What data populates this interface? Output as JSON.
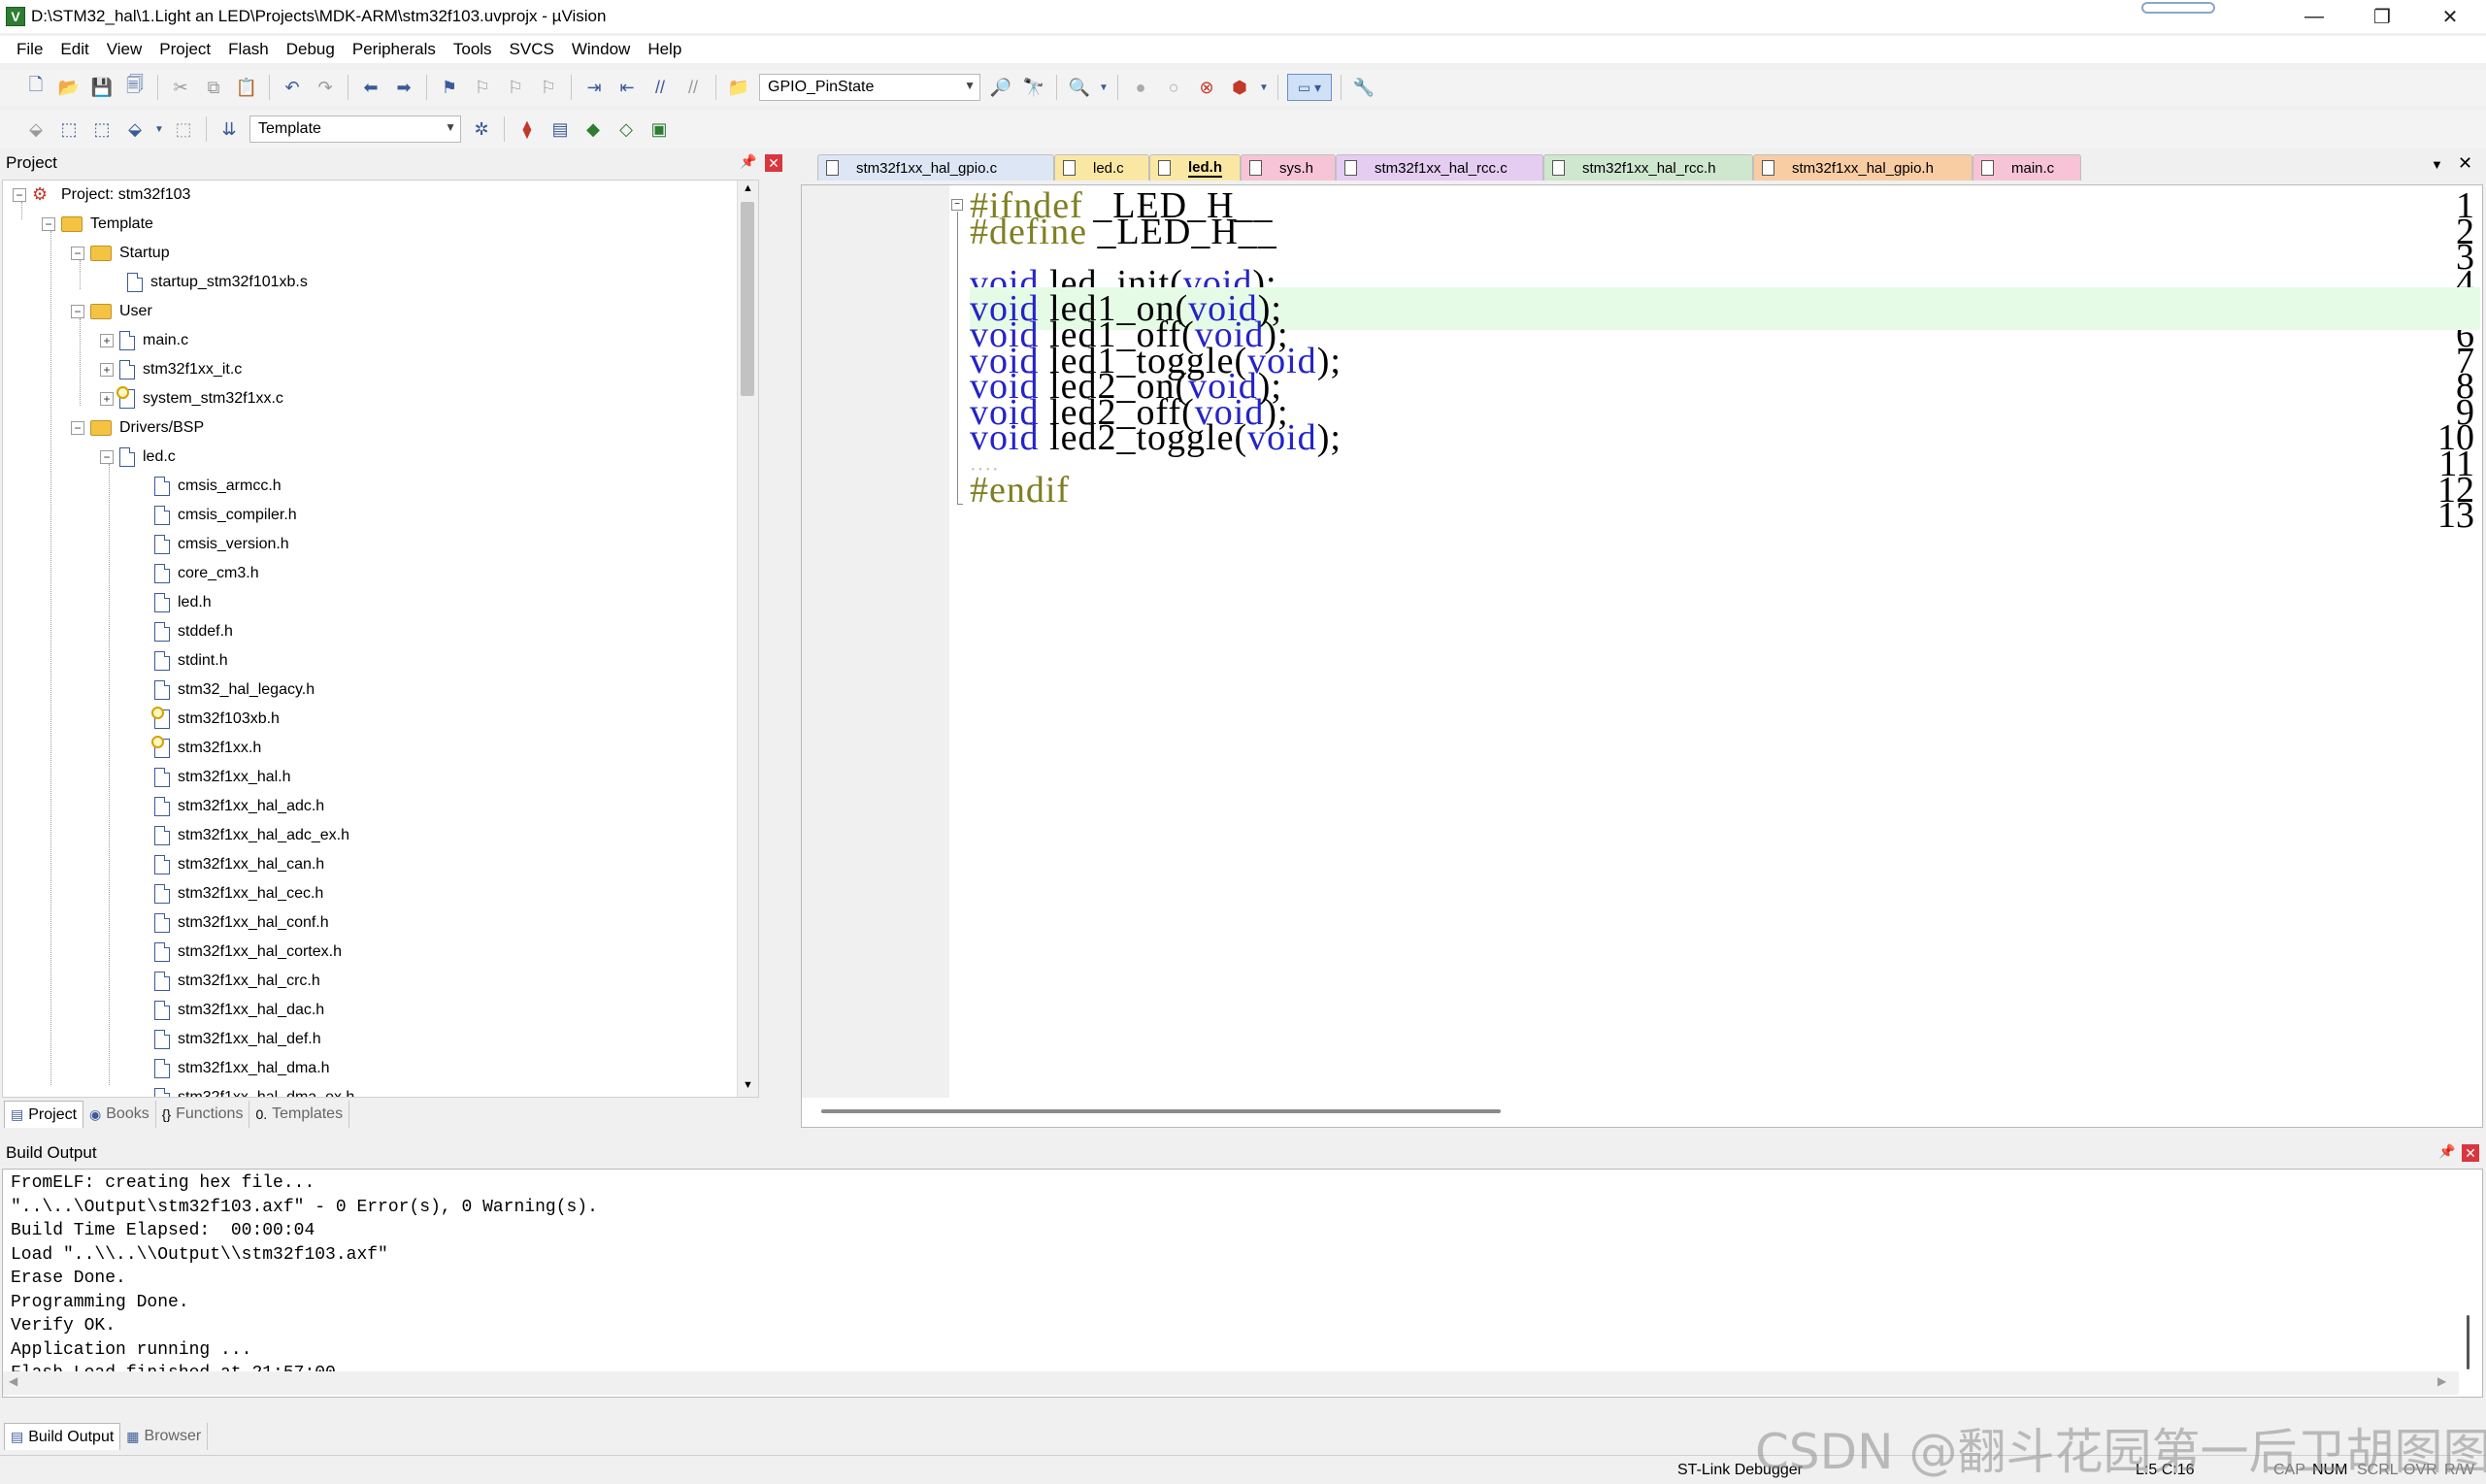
{
  "window": {
    "title": "D:\\STM32_hal\\1.Light an LED\\Projects\\MDK-ARM\\stm32f103.uvprojx - µVision",
    "minimize": "—",
    "restore": "❐",
    "close": "✕"
  },
  "menu": [
    "File",
    "Edit",
    "View",
    "Project",
    "Flash",
    "Debug",
    "Peripherals",
    "Tools",
    "SVCS",
    "Window",
    "Help"
  ],
  "toolbar1": {
    "find_combo": "GPIO_PinState"
  },
  "toolbar2": {
    "target_combo": "Template"
  },
  "project_panel": {
    "header": "Project",
    "tree": [
      {
        "label": "Project: stm32f103",
        "icon": "project-icon"
      },
      {
        "label": "Template",
        "icon": "folder-icon"
      },
      {
        "label": "Startup",
        "icon": "folder-icon"
      },
      {
        "label": "startup_stm32f101xb.s",
        "icon": "file-icon"
      },
      {
        "label": "User",
        "icon": "folder-icon"
      },
      {
        "label": "main.c",
        "icon": "file-icon"
      },
      {
        "label": "stm32f1xx_it.c",
        "icon": "file-icon"
      },
      {
        "label": "system_stm32f1xx.c",
        "icon": "key-file-icon"
      },
      {
        "label": "Drivers/BSP",
        "icon": "folder-icon"
      },
      {
        "label": "led.c",
        "icon": "file-icon"
      },
      {
        "label": "cmsis_armcc.h",
        "icon": "file-icon"
      },
      {
        "label": "cmsis_compiler.h",
        "icon": "file-icon"
      },
      {
        "label": "cmsis_version.h",
        "icon": "file-icon"
      },
      {
        "label": "core_cm3.h",
        "icon": "file-icon"
      },
      {
        "label": "led.h",
        "icon": "file-icon"
      },
      {
        "label": "stddef.h",
        "icon": "file-icon"
      },
      {
        "label": "stdint.h",
        "icon": "file-icon"
      },
      {
        "label": "stm32_hal_legacy.h",
        "icon": "file-icon"
      },
      {
        "label": "stm32f103xb.h",
        "icon": "key-file-icon"
      },
      {
        "label": "stm32f1xx.h",
        "icon": "key-file-icon"
      },
      {
        "label": "stm32f1xx_hal.h",
        "icon": "file-icon"
      },
      {
        "label": "stm32f1xx_hal_adc.h",
        "icon": "file-icon"
      },
      {
        "label": "stm32f1xx_hal_adc_ex.h",
        "icon": "file-icon"
      },
      {
        "label": "stm32f1xx_hal_can.h",
        "icon": "file-icon"
      },
      {
        "label": "stm32f1xx_hal_cec.h",
        "icon": "file-icon"
      },
      {
        "label": "stm32f1xx_hal_conf.h",
        "icon": "file-icon"
      },
      {
        "label": "stm32f1xx_hal_cortex.h",
        "icon": "file-icon"
      },
      {
        "label": "stm32f1xx_hal_crc.h",
        "icon": "file-icon"
      },
      {
        "label": "stm32f1xx_hal_dac.h",
        "icon": "file-icon"
      },
      {
        "label": "stm32f1xx_hal_def.h",
        "icon": "file-icon"
      },
      {
        "label": "stm32f1xx_hal_dma.h",
        "icon": "file-icon"
      },
      {
        "label": "stm32f1xx_hal_dma_ex.h",
        "icon": "file-icon"
      }
    ],
    "bottom_tabs": [
      "Project",
      "Books",
      "Functions",
      "Templates"
    ]
  },
  "editor_tabs": [
    {
      "label": "stm32f1xx_hal_gpio.c",
      "color": "#dce6f4",
      "active": false
    },
    {
      "label": "led.c",
      "color": "#fbe7a4",
      "active": false
    },
    {
      "label": "led.h",
      "color": "#fbe7a4",
      "active": true
    },
    {
      "label": "sys.h",
      "color": "#f6c4d6",
      "active": false
    },
    {
      "label": "stm32f1xx_hal_rcc.c",
      "color": "#e4cdf0",
      "active": false
    },
    {
      "label": "stm32f1xx_hal_rcc.h",
      "color": "#cfe6cf",
      "active": false
    },
    {
      "label": "stm32f1xx_hal_gpio.h",
      "color": "#f8cda4",
      "active": false
    },
    {
      "label": "main.c",
      "color": "#f6c4d6",
      "active": false
    }
  ],
  "code": {
    "line_numbers": [
      "1",
      "2",
      "3",
      "4",
      "5",
      "6",
      "7",
      "8",
      "9",
      "10",
      "11",
      "12",
      "13"
    ],
    "lines": [
      [
        {
          "t": "#ifndef",
          "c": "pp"
        },
        {
          "t": " _LED_H__",
          "c": ""
        }
      ],
      [
        {
          "t": "#define",
          "c": "pp"
        },
        {
          "t": " _LED_H__",
          "c": ""
        }
      ],
      [],
      [
        {
          "t": "void",
          "c": "kw"
        },
        {
          "t": " led_init(",
          "c": ""
        },
        {
          "t": "void",
          "c": "kw"
        },
        {
          "t": ");",
          "c": ""
        }
      ],
      [
        {
          "t": "void",
          "c": "kw"
        },
        {
          "t": " led1_on(",
          "c": ""
        },
        {
          "t": "void",
          "c": "kw"
        },
        {
          "t": ");",
          "c": ""
        }
      ],
      [
        {
          "t": "void",
          "c": "kw"
        },
        {
          "t": " led1_off(",
          "c": ""
        },
        {
          "t": "void",
          "c": "kw"
        },
        {
          "t": ");",
          "c": ""
        }
      ],
      [
        {
          "t": "void",
          "c": "kw"
        },
        {
          "t": " led1_toggle(",
          "c": ""
        },
        {
          "t": "void",
          "c": "kw"
        },
        {
          "t": ");",
          "c": ""
        }
      ],
      [
        {
          "t": "void",
          "c": "kw"
        },
        {
          "t": " led2_on(",
          "c": ""
        },
        {
          "t": "void",
          "c": "kw"
        },
        {
          "t": ");",
          "c": ""
        }
      ],
      [
        {
          "t": "void",
          "c": "kw"
        },
        {
          "t": " led2_off(",
          "c": ""
        },
        {
          "t": "void",
          "c": "kw"
        },
        {
          "t": ");",
          "c": ""
        }
      ],
      [
        {
          "t": "void",
          "c": "kw"
        },
        {
          "t": " led2_toggle(",
          "c": ""
        },
        {
          "t": "void",
          "c": "kw"
        },
        {
          "t": ");",
          "c": ""
        }
      ],
      [
        {
          "t": "····",
          "c": "ws-dots"
        }
      ],
      [
        {
          "t": "#endif",
          "c": "pp"
        }
      ],
      []
    ],
    "current_line": 5
  },
  "build_output": {
    "header": "Build Output",
    "lines": [
      "FromELF: creating hex file...",
      "\"..\\..\\Output\\stm32f103.axf\" - 0 Error(s), 0 Warning(s).",
      "Build Time Elapsed:  00:00:04",
      "Load \"..\\\\..\\\\Output\\\\stm32f103.axf\"",
      "Erase Done.",
      "Programming Done.",
      "Verify OK.",
      "Application running ...",
      "Flash Load finished at 21:57:00"
    ],
    "bottom_tabs": [
      "Build Output",
      "Browser"
    ]
  },
  "status": {
    "debugger": "ST-Link Debugger",
    "position": "L:5 C:16",
    "cap": "CAP",
    "num": "NUM",
    "scrl": "SCRL",
    "ovr": "OVR",
    "rw": "R/W"
  },
  "watermark": "CSDN @翻斗花园第一后卫胡图图"
}
